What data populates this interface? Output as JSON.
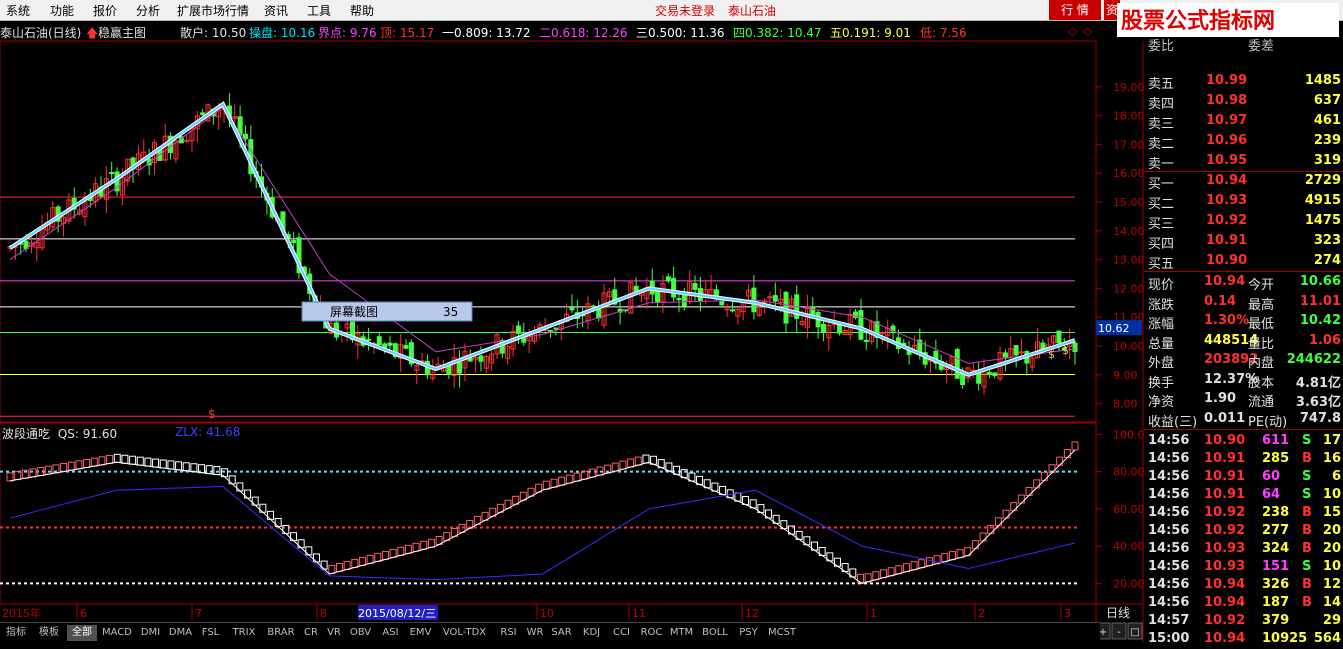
{
  "menu": {
    "items": [
      "系统",
      "功能",
      "报价",
      "分析",
      "扩展市场行情",
      "资讯",
      "工具",
      "帮助"
    ],
    "login_status": "交易未登录",
    "stock_name": "泰山石油",
    "btn_quote": "行 情",
    "btn_info": "资"
  },
  "logo": {
    "text": "股票公式指标网",
    "url": "www.gsxz.com.cn"
  },
  "chart": {
    "title": "泰山石油(日线)",
    "indicator": "稳赢主图",
    "info": [
      {
        "label": "散户: ",
        "value": "10.50",
        "color": "#e0e0e0"
      },
      {
        "label": "操盘: ",
        "value": "10.16",
        "color": "#00e0ff"
      },
      {
        "label": "界点: ",
        "value": "9.76",
        "color": "#ff40ff"
      },
      {
        "label": "顶: ",
        "value": "15.17",
        "color": "#ff3030"
      },
      {
        "label": "一0.809: ",
        "value": "13.72",
        "color": "#ffffff"
      },
      {
        "label": "二0.618: ",
        "value": "12.26",
        "color": "#ff40ff"
      },
      {
        "label": "三0.500: ",
        "value": "11.36",
        "color": "#ffffff"
      },
      {
        "label": "四0.382: ",
        "value": "10.47",
        "color": "#40ff40"
      },
      {
        "label": "五0.191: ",
        "value": "9.01",
        "color": "#ffff40"
      },
      {
        "label": "低: ",
        "value": "7.56",
        "color": "#ff3030"
      }
    ],
    "price_axis": [
      "19.00",
      "18.00",
      "17.00",
      "16.00",
      "15.00",
      "14.00",
      "13.00",
      "12.00",
      "11.00",
      "10.00",
      "9.00",
      "8.00"
    ],
    "current_price_tag": "10.62",
    "tooltip_label": "屏幕截图",
    "tooltip_value": "35",
    "signal_mark": "$",
    "coin_mark": "$"
  },
  "sub_chart": {
    "title": "波段通吃",
    "qs": "QS: 91.60",
    "zlx": "ZLX: 41.68",
    "axis": [
      "100.0",
      "80.00",
      "60.00",
      "40.00",
      "20.00"
    ]
  },
  "date_axis": {
    "labels": [
      "2015年",
      "6",
      "7",
      "8",
      "2015/08/12/三",
      "10",
      "11",
      "12",
      "1",
      "2",
      "3"
    ],
    "period": "日线"
  },
  "chart_data": {
    "type": "line",
    "title": "泰山石油(日线)",
    "x": [
      "2015-05",
      "2015-06",
      "2015-07",
      "2015-08",
      "2015-09",
      "2015-10",
      "2015-11",
      "2015-12",
      "2016-01",
      "2016-02",
      "2016-03"
    ],
    "series": [
      {
        "name": "操盘",
        "values": [
          13.4,
          15.8,
          18.4,
          10.6,
          9.2,
          10.6,
          12.0,
          11.5,
          10.6,
          9.0,
          10.2
        ]
      },
      {
        "name": "界点",
        "values": [
          13.0,
          15.5,
          18.3,
          12.5,
          9.8,
          10.4,
          11.5,
          11.6,
          11.0,
          9.4,
          9.9
        ]
      }
    ],
    "ylim": [
      7.5,
      20.0
    ],
    "levels": {
      "顶": 15.17,
      "一0.809": 13.72,
      "二0.618": 12.26,
      "三0.500": 11.36,
      "四0.382": 10.47,
      "五0.191": 9.01,
      "低": 7.56
    },
    "indicator": {
      "name": "波段通吃",
      "ylim": [
        10,
        105
      ],
      "levels": [
        80,
        50,
        20
      ],
      "ZLX": [
        55,
        70,
        72,
        24,
        22,
        25,
        60,
        70,
        40,
        28,
        41.68
      ],
      "QS": [
        75,
        85,
        78,
        25,
        40,
        70,
        85,
        60,
        20,
        35,
        91.6
      ]
    }
  },
  "quote": {
    "top_partial": [
      "委比",
      "",
      "委差",
      ""
    ],
    "asks": [
      {
        "label": "卖五",
        "price": "10.99",
        "vol": "1485"
      },
      {
        "label": "卖四",
        "price": "10.98",
        "vol": "637"
      },
      {
        "label": "卖三",
        "price": "10.97",
        "vol": "461"
      },
      {
        "label": "卖二",
        "price": "10.96",
        "vol": "239"
      },
      {
        "label": "卖一",
        "price": "10.95",
        "vol": "319"
      }
    ],
    "bids": [
      {
        "label": "买一",
        "price": "10.94",
        "vol": "2729"
      },
      {
        "label": "买二",
        "price": "10.93",
        "vol": "4915"
      },
      {
        "label": "买三",
        "price": "10.92",
        "vol": "1475"
      },
      {
        "label": "买四",
        "price": "10.91",
        "vol": "323"
      },
      {
        "label": "买五",
        "price": "10.90",
        "vol": "274"
      }
    ],
    "stats": [
      {
        "l1": "现价",
        "v1": "10.94",
        "c1": "#ff3030",
        "l2": "今开",
        "v2": "10.66",
        "c2": "#40ff40"
      },
      {
        "l1": "涨跌",
        "v1": "0.14",
        "c1": "#ff3030",
        "l2": "最高",
        "v2": "11.01",
        "c2": "#ff3030"
      },
      {
        "l1": "涨幅",
        "v1": "1.30%",
        "c1": "#ff3030",
        "l2": "最低",
        "v2": "10.42",
        "c2": "#40ff40"
      },
      {
        "l1": "总量",
        "v1": "448514",
        "c1": "#ffff40",
        "l2": "量比",
        "v2": "1.06",
        "c2": "#ff3030"
      },
      {
        "l1": "外盘",
        "v1": "203892",
        "c1": "#ff3030",
        "l2": "内盘",
        "v2": "244622",
        "c2": "#40ff40"
      },
      {
        "l1": "换手",
        "v1": "12.37%",
        "c1": "#e0e0e0",
        "l2": "股本",
        "v2": "4.81亿",
        "c2": "#e0e0e0"
      },
      {
        "l1": "净资",
        "v1": "1.90",
        "c1": "#e0e0e0",
        "l2": "流通",
        "v2": "3.63亿",
        "c2": "#e0e0e0"
      },
      {
        "l1": "收益(三)",
        "v1": "0.011",
        "c1": "#e0e0e0",
        "l2": "PE(动)",
        "v2": "747.8",
        "c2": "#e0e0e0"
      }
    ],
    "ticks": [
      {
        "t": "14:56",
        "p": "10.90",
        "v": "611",
        "bs": "S",
        "n": "17"
      },
      {
        "t": "14:56",
        "p": "10.91",
        "v": "285",
        "bs": "B",
        "n": "16"
      },
      {
        "t": "14:56",
        "p": "10.91",
        "v": "60",
        "bs": "S",
        "n": "6"
      },
      {
        "t": "14:56",
        "p": "10.91",
        "v": "64",
        "bs": "S",
        "n": "10"
      },
      {
        "t": "14:56",
        "p": "10.92",
        "v": "238",
        "bs": "B",
        "n": "15"
      },
      {
        "t": "14:56",
        "p": "10.92",
        "v": "277",
        "bs": "B",
        "n": "20"
      },
      {
        "t": "14:56",
        "p": "10.93",
        "v": "324",
        "bs": "B",
        "n": "20"
      },
      {
        "t": "14:56",
        "p": "10.93",
        "v": "151",
        "bs": "S",
        "n": "10"
      },
      {
        "t": "14:56",
        "p": "10.94",
        "v": "326",
        "bs": "B",
        "n": "12"
      },
      {
        "t": "14:56",
        "p": "10.94",
        "v": "187",
        "bs": "B",
        "n": "14"
      },
      {
        "t": "14:57",
        "p": "10.92",
        "v": "379",
        "bs": "",
        "n": "29"
      },
      {
        "t": "15:00",
        "p": "10.94",
        "v": "10925",
        "bs": "",
        "n": "564"
      }
    ]
  },
  "tabs": [
    "指标",
    "模板",
    "全部",
    "MACD",
    "DMI",
    "DMA",
    "FSL",
    "TRIX",
    "BRAR",
    "CR",
    "VR",
    "OBV",
    "ASI",
    "EMV",
    "VOL-TDX",
    "RSI",
    "WR",
    "SAR",
    "KDJ",
    "CCI",
    "ROC",
    "MTM",
    "BOLL",
    "PSY",
    "MCST"
  ],
  "bottom_controls": [
    "+",
    "-",
    "□"
  ]
}
